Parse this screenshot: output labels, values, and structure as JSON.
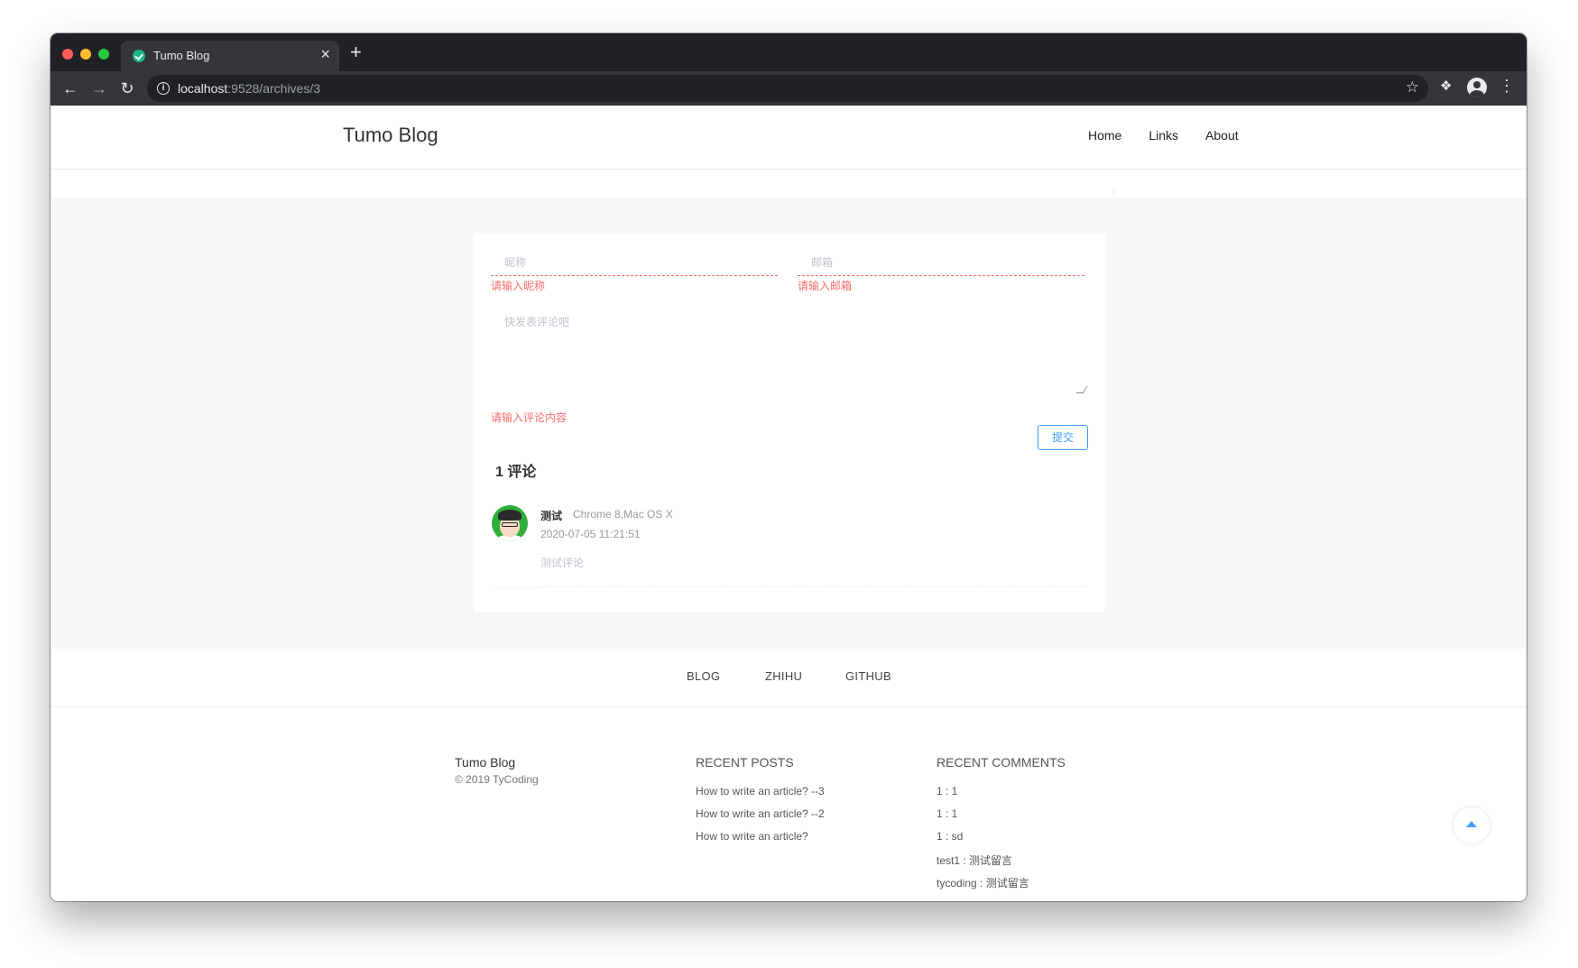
{
  "browser": {
    "tab_title": "Tumo Blog",
    "tab_close": "×",
    "new_tab": "+",
    "url_host": "localhost",
    "url_rest": ":9528/archives/3",
    "icons": [
      "back-arrow-icon",
      "forward-arrow-icon",
      "reload-icon",
      "info-icon",
      "star-icon",
      "extensions-icon",
      "profile-icon",
      "menu-icon"
    ]
  },
  "header": {
    "site_title": "Tumo Blog",
    "nav": [
      {
        "label": "Home"
      },
      {
        "label": "Links"
      },
      {
        "label": "About"
      }
    ]
  },
  "comment_form": {
    "nickname_placeholder": "昵称",
    "email_placeholder": "邮箱",
    "content_placeholder": "快发表评论吧",
    "nickname_error": "请输入昵称",
    "email_error": "请输入邮箱",
    "content_error": "请输入评论内容",
    "submit_label": "提交"
  },
  "comments": {
    "count_title": "1 评论",
    "items": [
      {
        "name": "测试",
        "user_agent": "Chrome 8,Mac OS X",
        "time": "2020-07-05 11:21:51",
        "content": "测试评论"
      }
    ]
  },
  "footer": {
    "links": [
      {
        "label": "BLOG"
      },
      {
        "label": "ZHIHU"
      },
      {
        "label": "GITHUB"
      }
    ],
    "brand": {
      "title": "Tumo Blog",
      "copyright": "© 2019 TyCoding"
    },
    "recent_posts": {
      "title": "RECENT POSTS",
      "items": [
        "How to write an article? --3",
        "How to write an article? --2",
        "How to write an article?"
      ]
    },
    "recent_comments": {
      "title": "RECENT COMMENTS",
      "items": [
        "1 : 1",
        "1 : 1",
        "1 : sd",
        "test1 : 测试留言",
        "tycoding : 测试留言"
      ]
    }
  },
  "colors": {
    "accent": "#409eff",
    "error": "#f56c6c",
    "page_gray": "#f7f7f7"
  }
}
